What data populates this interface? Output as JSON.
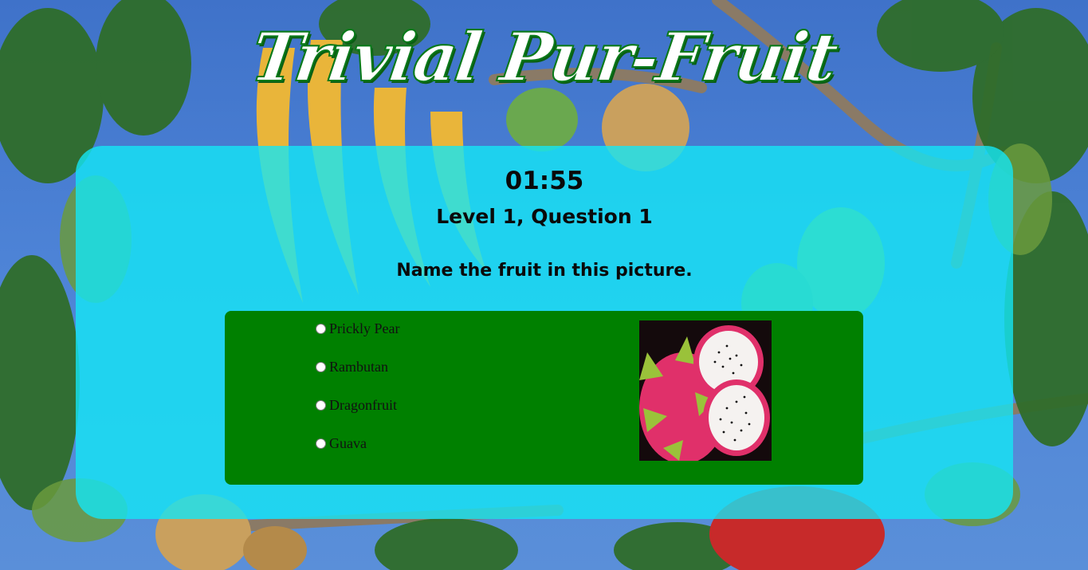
{
  "app": {
    "title": "Trivial Pur-Fruit"
  },
  "quiz": {
    "timer": "01:55",
    "level_label": "Level 1, Question 1",
    "question": "Name the fruit in this picture.",
    "options": [
      {
        "label": "Prickly Pear",
        "selected": false
      },
      {
        "label": "Rambutan",
        "selected": false
      },
      {
        "label": "Dragonfruit",
        "selected": false
      },
      {
        "label": "Guava",
        "selected": false
      }
    ],
    "image_subject": "dragonfruit"
  },
  "colors": {
    "panel": "#14e6f5",
    "answer_box": "#008000",
    "title_fill": "#ffffff",
    "title_outline": "#0a7a1a",
    "sky": "#4d83d6"
  },
  "icons": [
    "radio-button-icon",
    "dragonfruit-image"
  ]
}
